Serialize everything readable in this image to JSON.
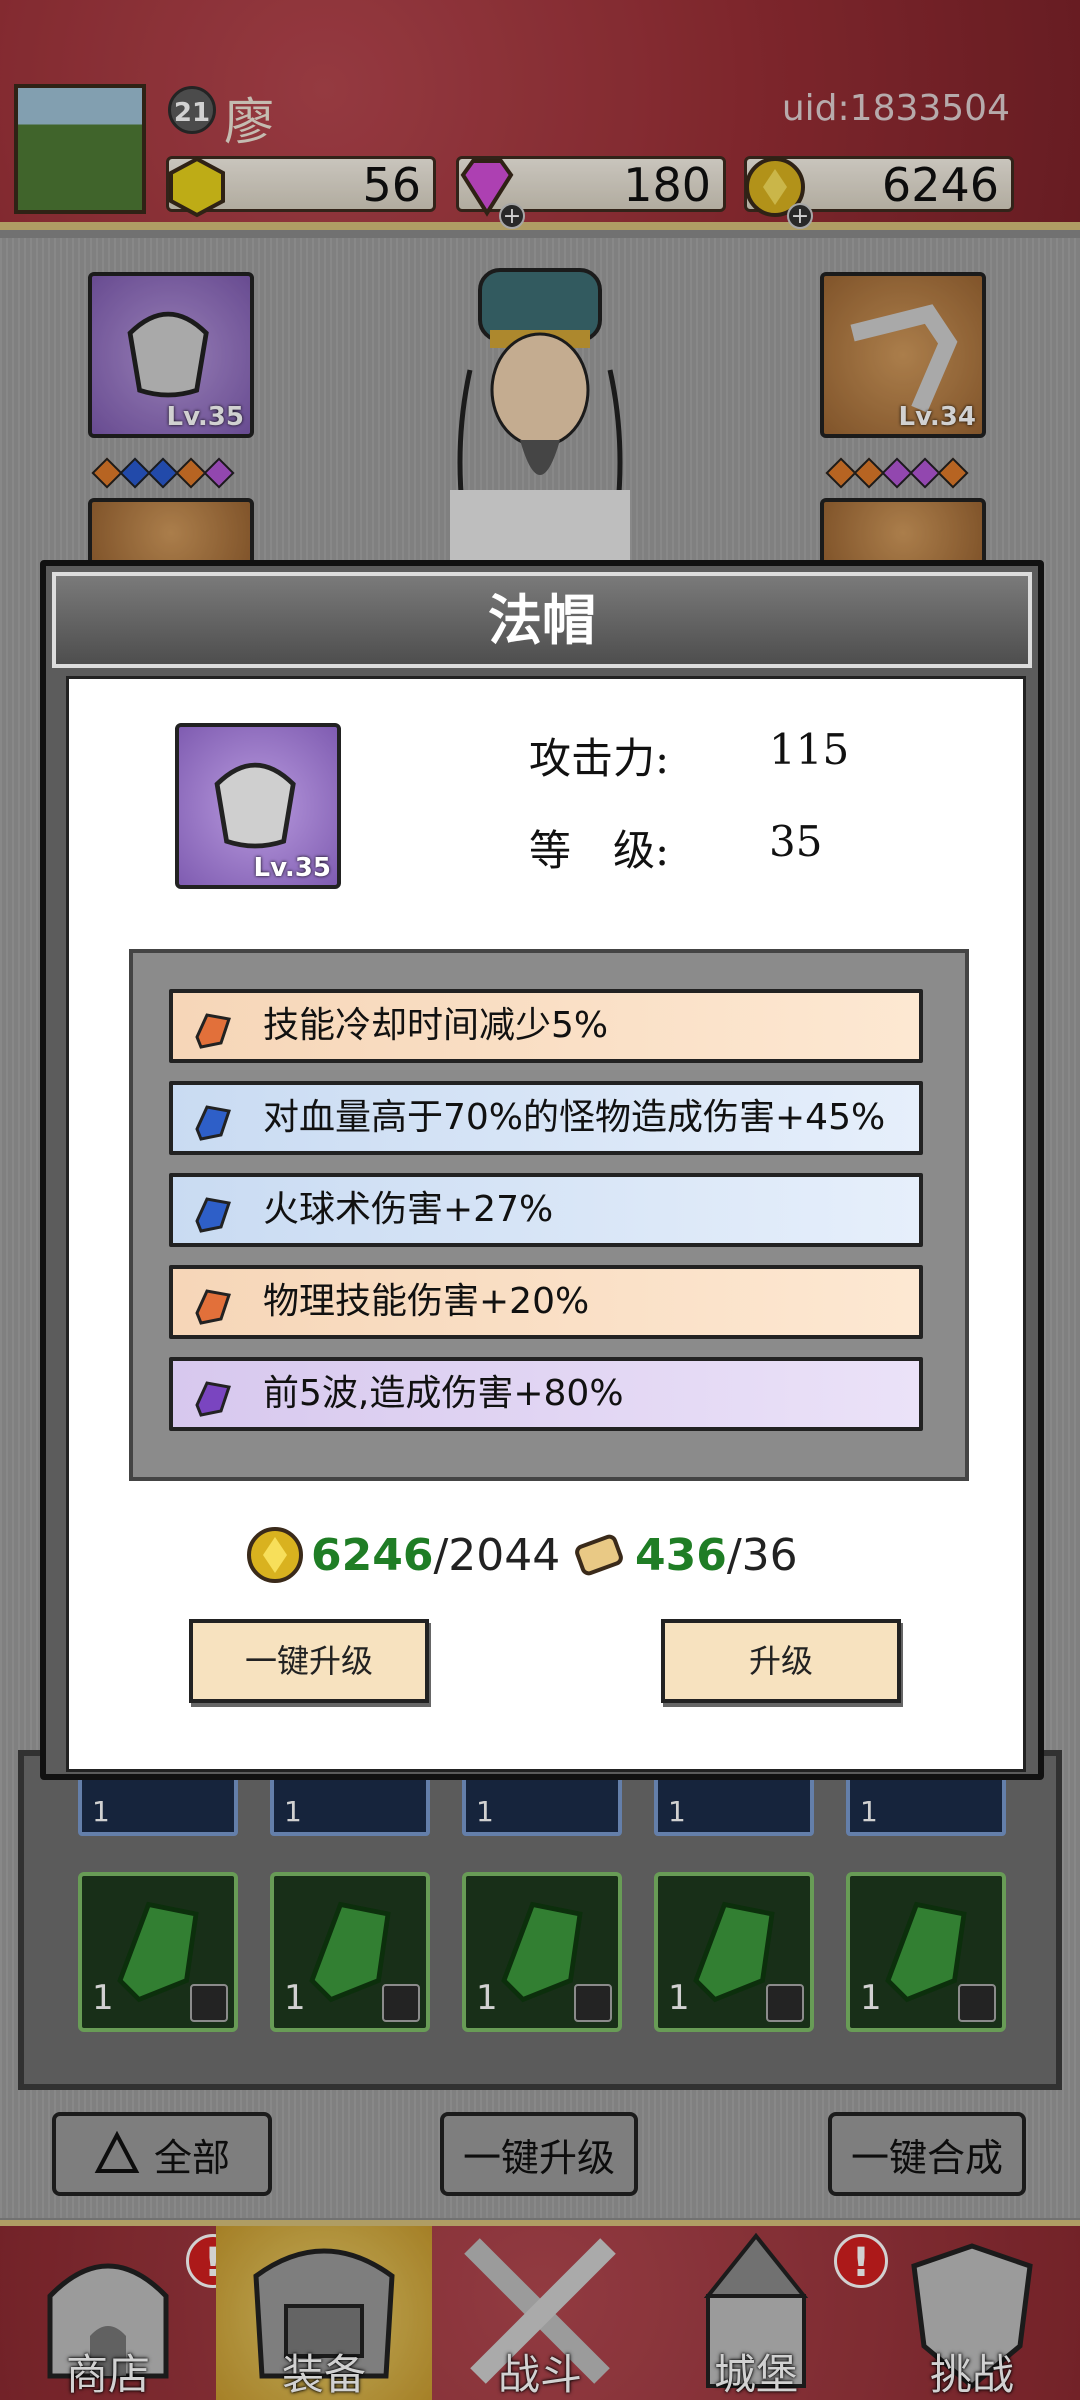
{
  "header": {
    "player_level": "21",
    "player_name": "廖",
    "uid": "uid:1833504",
    "resources": [
      {
        "name": "gold-gem",
        "value": "56"
      },
      {
        "name": "diamond",
        "value": "180"
      },
      {
        "name": "coin",
        "value": "6246"
      }
    ]
  },
  "equipment": {
    "slot_left_level": "Lv.35",
    "slot_right_level": "Lv.34"
  },
  "modal": {
    "title": "法帽",
    "item_level_badge": "Lv.35",
    "stats": [
      {
        "label": "攻击力:",
        "value": "115"
      },
      {
        "label": "等　级:",
        "value": "35"
      }
    ],
    "attributes": [
      {
        "text": "技能冷却时间减少5%",
        "color": "orange"
      },
      {
        "text": "对血量高于70%的怪物造成伤害+45%",
        "color": "blue"
      },
      {
        "text": "火球术伤害+27%",
        "color": "blue"
      },
      {
        "text": "物理技能伤害+20%",
        "color": "orange"
      },
      {
        "text": "前5波,造成伤害+80%",
        "color": "purple"
      }
    ],
    "cost_coin": {
      "have": "6246",
      "need": "/2044"
    },
    "cost_scroll": {
      "have": "436",
      "need": "/36"
    },
    "btn_auto_upgrade": "一键升级",
    "btn_upgrade": "升级"
  },
  "bag": {
    "green_counts": [
      "1",
      "1",
      "1",
      "1",
      "1"
    ],
    "blue_counts": [
      "1",
      "1",
      "1",
      "1",
      "1"
    ]
  },
  "bottom_buttons": {
    "filter_all": "全部",
    "auto_upgrade": "一键升级",
    "auto_merge": "一键合成"
  },
  "nav": [
    {
      "label": "商店",
      "badge": "!"
    },
    {
      "label": "装备",
      "badge": ""
    },
    {
      "label": "战斗",
      "badge": ""
    },
    {
      "label": "城堡",
      "badge": "!"
    },
    {
      "label": "挑战",
      "badge": ""
    }
  ],
  "colors": {
    "header_red": "#9a2f36",
    "accent_gold": "#d6c07a",
    "have_green": "#1f7d25"
  }
}
